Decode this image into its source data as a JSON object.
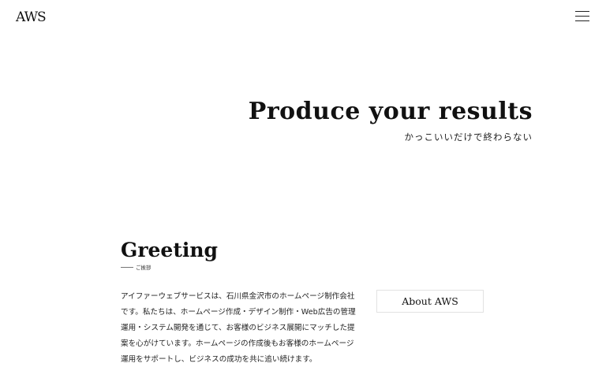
{
  "header": {
    "logo_text": "AWS",
    "menu_icon": "hamburger-icon"
  },
  "hero": {
    "title": "Produce your results",
    "subtitle": "かっこいいだけで終わらない"
  },
  "greeting": {
    "title": "Greeting",
    "subtitle": "ご挨拶",
    "lines": [
      "アイファーウェブサービスは、石川県金沢市のホームページ制作会社",
      "です。私たちは、ホームページ作成・デザイン制作・Web広告の管理",
      "運用・システム開発を通じて、お客様のビジネス展開にマッチした提",
      "案を心がけています。ホームページの作成後もお客様のホームページ",
      "運用をサポートし、ビジネスの成功を共に追い続けます。"
    ],
    "about_button": "About AWS"
  }
}
